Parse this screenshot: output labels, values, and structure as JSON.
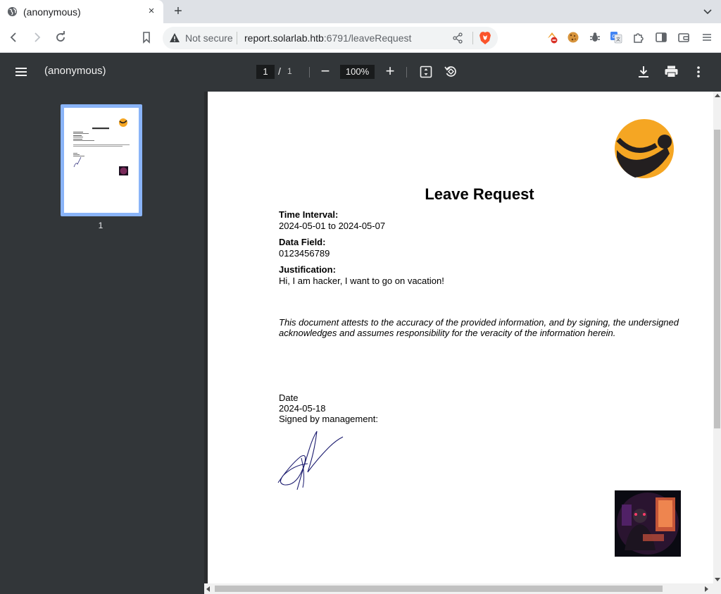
{
  "browser": {
    "tab_title": "(anonymous)",
    "tab_close": "×",
    "new_tab": "+",
    "security_label": "Not secure",
    "url_host": "report.solarlab.htb",
    "url_rest": ":6791/leaveRequest"
  },
  "pdf_toolbar": {
    "title": "(anonymous)",
    "current_page": "1",
    "page_separator": "/",
    "total_pages": "1",
    "zoom": "100%",
    "zoom_out": "−",
    "zoom_in": "+"
  },
  "sidebar": {
    "thumbnail_label": "1"
  },
  "document": {
    "title": "Leave Request",
    "time_interval_label": "Time Interval:",
    "time_interval_value": "2024-05-01 to 2024-05-07",
    "data_field_label": "Data Field:",
    "data_field_value": "0123456789",
    "justification_label": "Justification:",
    "justification_value": "Hi, I am hacker, I want to go on vacation!",
    "attestation": "This document attests to the accuracy of the provided information, and by signing, the undersigned acknowledges and assumes responsibility for the veracity of the information herein.",
    "date_label": "Date",
    "date_value": "2024-05-18",
    "signed_label": "Signed by management:"
  },
  "colors": {
    "pdf_toolbar_bg": "#323639",
    "thumbnail_border": "#8ab4f8",
    "logo_orange": "#f5a623",
    "logo_dark": "#231f20",
    "signature_ink": "#1a1a6e"
  },
  "icons": {
    "browser": [
      "globe-icon",
      "close-icon",
      "plus-icon",
      "chevron-down-icon",
      "back-arrow-icon",
      "forward-arrow-icon",
      "reload-icon",
      "bookmark-icon",
      "warning-icon",
      "share-icon",
      "brave-shield-icon",
      "extensions-puzzle-icon",
      "sidebar-icon",
      "wallet-icon",
      "menu-icon"
    ],
    "pdf": [
      "hamburger-menu-icon",
      "fit-page-icon",
      "rotate-icon",
      "download-icon",
      "print-icon",
      "more-vert-icon"
    ]
  }
}
